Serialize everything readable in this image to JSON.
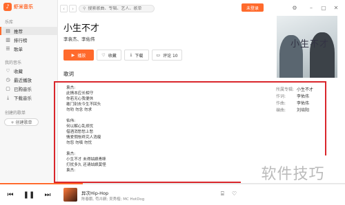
{
  "app": {
    "logo_text": "虾米音乐"
  },
  "sidebar": {
    "section_library": "乐库",
    "library_items": [
      {
        "label": "推荐",
        "icon": "recommend-icon"
      },
      {
        "label": "排行榜",
        "icon": "chart-icon"
      },
      {
        "label": "歌单",
        "icon": "playlist-icon"
      }
    ],
    "section_mine": "我的音乐",
    "mine_items": [
      {
        "label": "收藏",
        "icon": "heart-icon"
      },
      {
        "label": "最近播放",
        "icon": "clock-icon"
      },
      {
        "label": "已购音乐",
        "icon": "bag-icon"
      },
      {
        "label": "下载音乐",
        "icon": "download-icon"
      }
    ],
    "section_created": "创建的歌单",
    "create_label": "+ 创建歌单"
  },
  "topbar": {
    "search_placeholder": "搜索歌曲、专辑、艺人、歌单",
    "login_label": "未登录"
  },
  "song": {
    "title": "小生不才",
    "artists": "李袁杰、李佑伟",
    "actions": {
      "play": "播放",
      "collect": "收藏",
      "download": "下载",
      "comment": "评论 10"
    }
  },
  "lyrics": {
    "heading": "歌词",
    "lines": [
      "袁杰:",
      "此情本应长相守",
      "你若无心我便休",
      "敢门别去今生不回头",
      "勿劝  勿念  勿求",
      "",
      "佑伟:",
      "何以解心乱烦忧",
      "借酒消愁愁上愁",
      "情爱惆怅终究人消瘦",
      "勿怨  勿嗔  勿忧",
      "",
      "袁杰:",
      "小生不才  未得姑娘青睐",
      "打扰多久  还请姑娘莫怪",
      "袁杰:"
    ]
  },
  "cover": {
    "art_text": "小生不才"
  },
  "meta": [
    {
      "key": "所属专辑:",
      "value": "小生不才"
    },
    {
      "key": "作词:",
      "value": "李佑伟"
    },
    {
      "key": "作曲:",
      "value": "李佑伟"
    },
    {
      "key": "编曲:",
      "value": "刘培阳"
    }
  ],
  "watermark": "软件技巧",
  "player": {
    "now_title": "异次Hip-Hop",
    "now_sub": "陈春鹏, 苟卉嗣; 吴秀楷; MC HotDog",
    "progress": 0.24
  },
  "colors": {
    "accent": "#ff6a2c",
    "highlight": "#d9252a"
  }
}
